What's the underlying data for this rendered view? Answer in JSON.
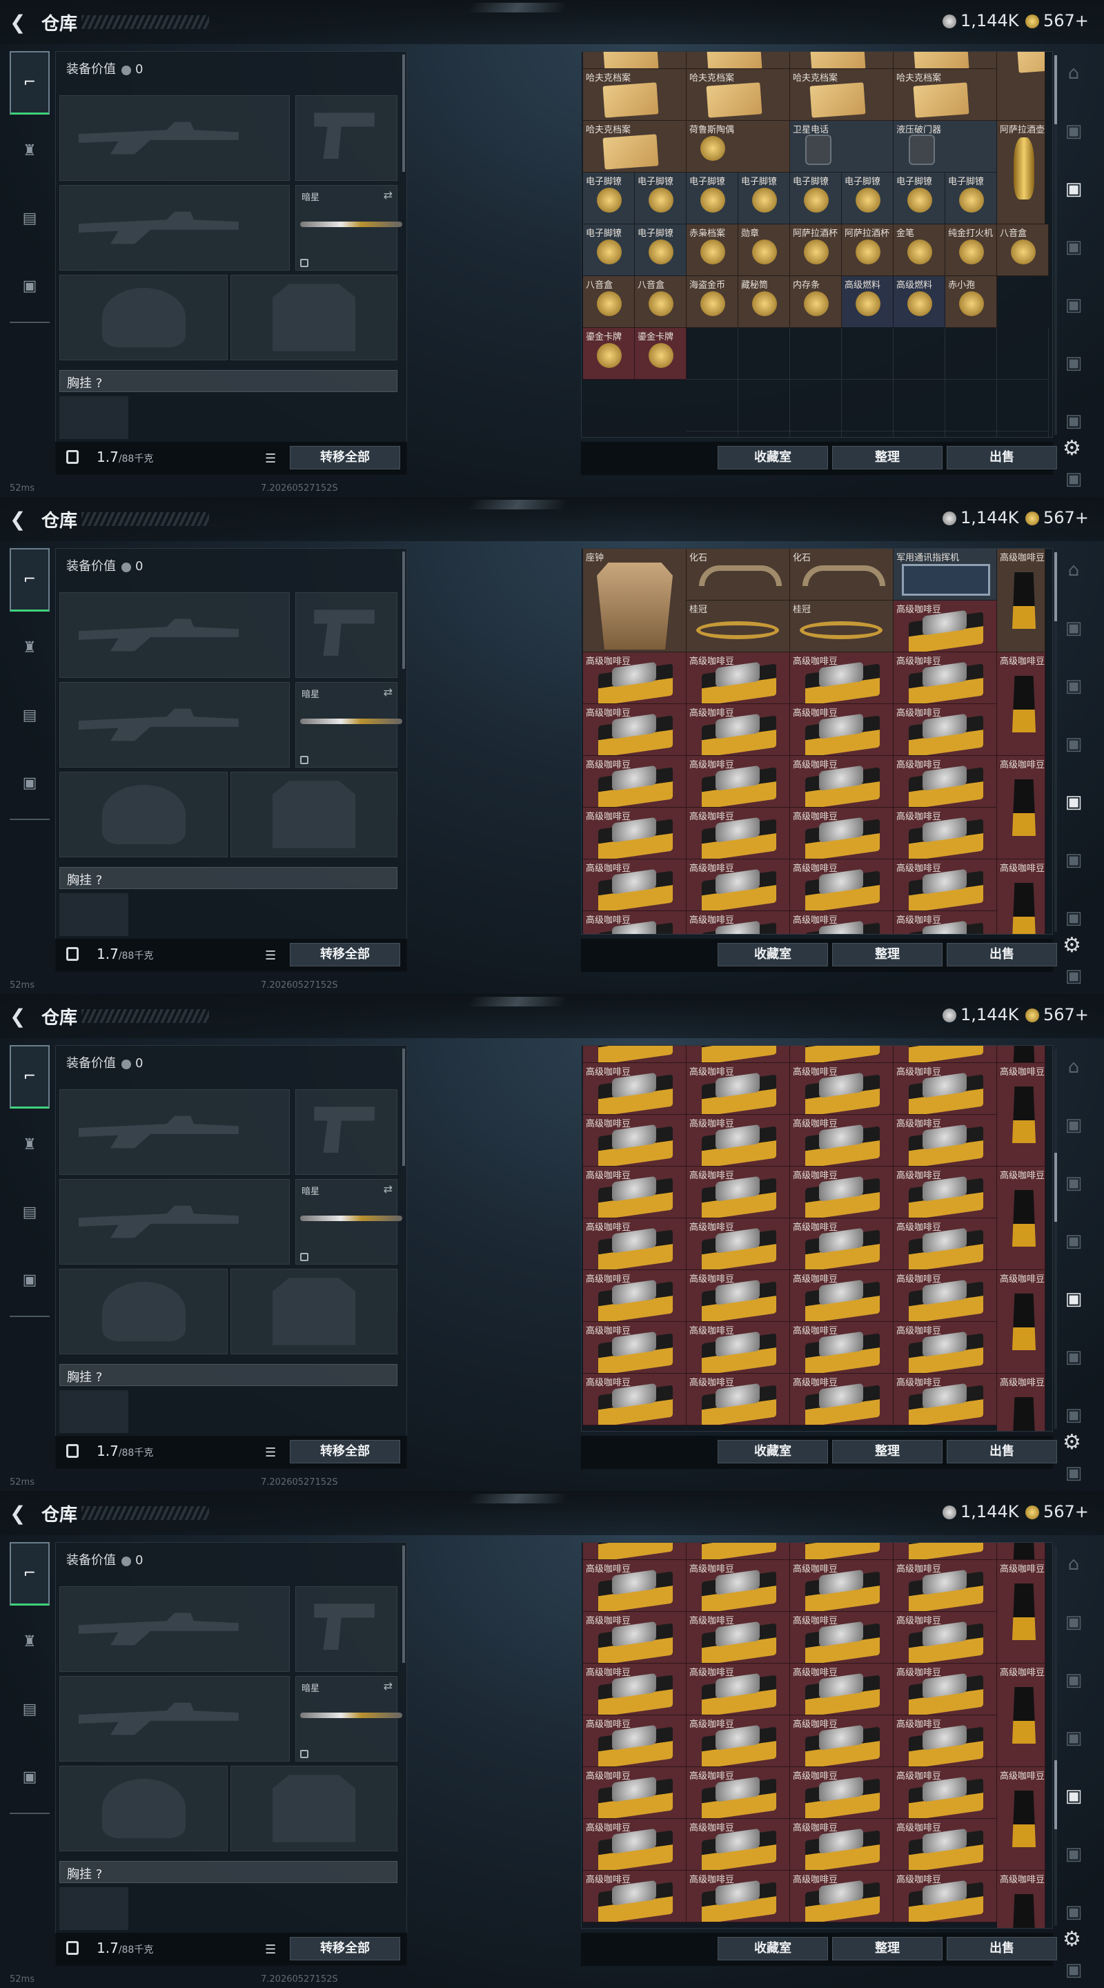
{
  "header": {
    "title": "仓库",
    "silver": "1,144K",
    "gold": "567+"
  },
  "left": {
    "equip_value_label": "装备价值",
    "equip_value": "0",
    "knife_name": "暗星",
    "chest_label": "胸挂 ?",
    "weight": "1.7",
    "weight_cap": "/88千克",
    "transfer_all": "转移全部"
  },
  "footer": {
    "ping": "52ms",
    "build": "7.20260527152S"
  },
  "buttons": {
    "collection": "收藏室",
    "sort": "整理",
    "sell": "出售"
  },
  "colors": {
    "item_gold": "#4a3a30",
    "item_red": "#5a2a30",
    "green_accent": "#3fd27e"
  },
  "screens": [
    {
      "items": [
        {
          "n": "哈夫克档案",
          "c": "brown",
          "k": "paper"
        },
        {
          "n": "哈夫克档案",
          "c": "brown",
          "k": "paper"
        },
        {
          "n": "哈夫克档案",
          "c": "brown",
          "k": "paper"
        },
        {
          "n": "哈夫克档案",
          "c": "brown",
          "k": "paper"
        },
        {
          "n": "哈夫克档案",
          "c": "brown",
          "k": "paper"
        },
        {
          "n": "荷鲁斯陶偶",
          "c": "brown",
          "k": "gold"
        },
        {
          "n": "卫星电话",
          "c": "grey",
          "k": "dev"
        },
        {
          "n": "液压破门器",
          "c": "grey",
          "k": "dev"
        },
        {
          "n": "阿萨拉酒壶",
          "c": "brown",
          "k": "vase"
        }
      ],
      "small": [
        {
          "n": "电子脚镣"
        },
        {
          "n": "电子脚镣"
        },
        {
          "n": "电子脚镣"
        },
        {
          "n": "电子脚镣"
        },
        {
          "n": "电子脚镣"
        },
        {
          "n": "电子脚镣"
        },
        {
          "n": "电子脚镣"
        },
        {
          "n": "电子脚镣"
        },
        {
          "n": "电子脚镣"
        },
        {
          "n": "电子脚镣"
        },
        {
          "n": "赤枭档案"
        },
        {
          "n": "勋章"
        },
        {
          "n": "阿萨拉酒杯"
        },
        {
          "n": "阿萨拉酒杯"
        },
        {
          "n": "金笔"
        },
        {
          "n": "纯金打火机"
        },
        {
          "n": "八音盒"
        },
        {
          "n": "八音盒"
        },
        {
          "n": "八音盒"
        },
        {
          "n": "海盗金币"
        },
        {
          "n": "藏秘筒"
        },
        {
          "n": "内存条"
        },
        {
          "n": "高级燃料"
        },
        {
          "n": "高级燃料"
        },
        {
          "n": "赤小孢"
        },
        {
          "n": "鎏金卡牌"
        },
        {
          "n": "鎏金卡牌"
        }
      ]
    },
    {
      "items": [
        {
          "n": "座钟"
        },
        {
          "n": "化石"
        },
        {
          "n": "化石"
        },
        {
          "n": "军用通讯指挥机"
        },
        {
          "n": "高级咖啡豆"
        },
        {
          "n": "桂冠"
        },
        {
          "n": "桂冠"
        },
        {
          "n": "高级咖啡豆"
        }
      ]
    },
    {
      "items": []
    },
    {
      "items": []
    }
  ],
  "bean_label": "高级咖啡豆"
}
